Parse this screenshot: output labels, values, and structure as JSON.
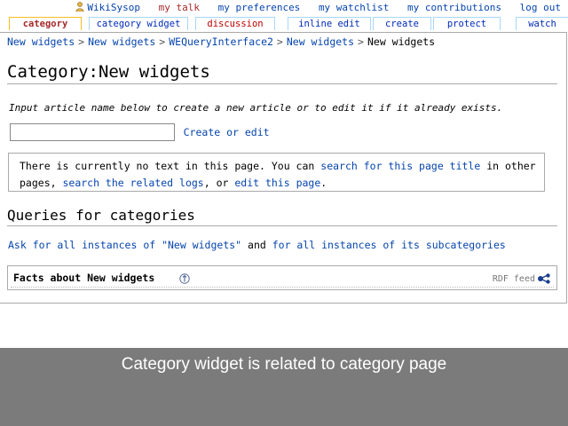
{
  "personal": {
    "username": "WikiSysop",
    "talk": "my talk",
    "preferences": "my preferences",
    "watchlist": "my watchlist",
    "contributions": "my contributions",
    "logout": "log out"
  },
  "tabs": {
    "category": "category",
    "category_widget": "category widget",
    "discussion": "discussion",
    "inline_edit": "inline edit",
    "create": "create",
    "protect": "protect",
    "watch": "watch"
  },
  "breadcrumb": [
    "New widgets",
    "New widgets",
    "WEQueryInterface2",
    "New widgets",
    "New widgets"
  ],
  "page": {
    "title": "Category:New widgets",
    "intro": "Input article name below to create a new article or to edit it if it already exists.",
    "input_value": "",
    "create_link": "Create or edit",
    "notice": {
      "text1": "There is currently no text in this page. You can ",
      "search_link": "search for this page title",
      "text2": " in other pages, ",
      "logs_link": "search the related logs",
      "text3": ", or ",
      "edit_link": "edit this page",
      "text4": "."
    },
    "queries_heading": "Queries for categories",
    "ask": {
      "link1": "Ask for all instances of \"New widgets\"",
      "middle": " and ",
      "link2": "for all instances of its subcategories"
    },
    "facts_title": "Facts about New widgets",
    "rdf_label": "RDF feed"
  },
  "caption": "Category widget is related to category page",
  "colors": {
    "overlay": "#7b7b7b",
    "link": "#0645ad",
    "talk": "#a52a2a",
    "category_tab_border": "#fabd23"
  }
}
